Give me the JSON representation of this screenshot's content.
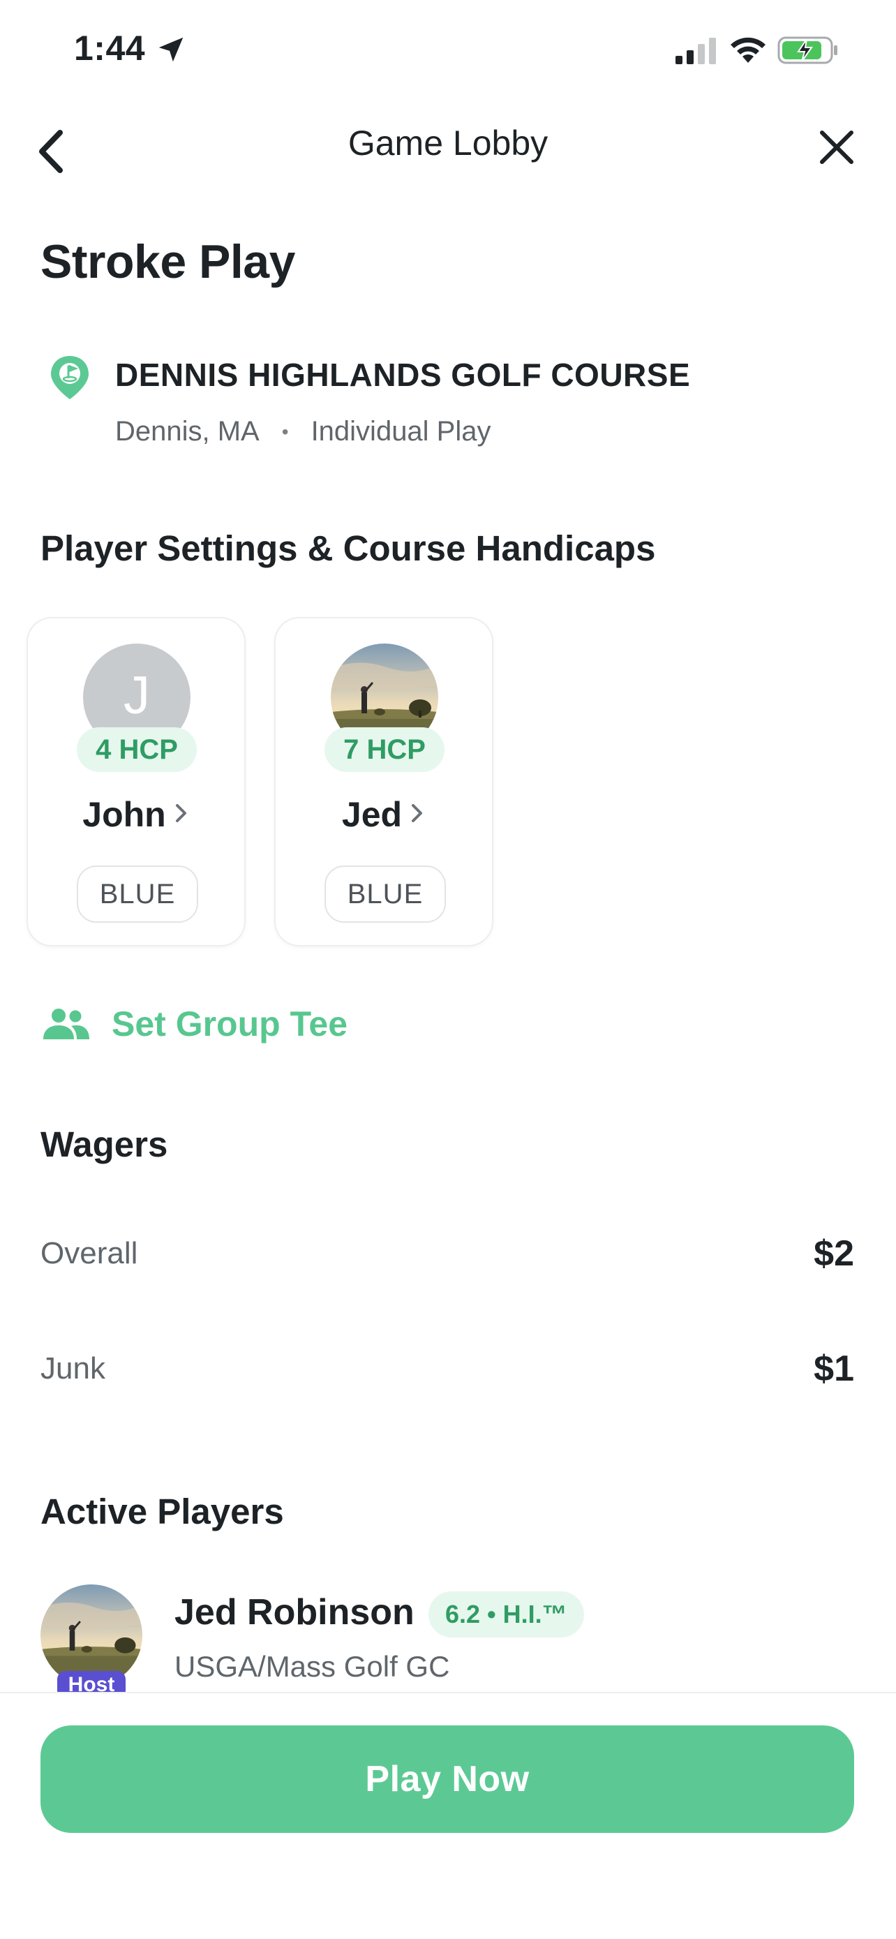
{
  "status_bar": {
    "time": "1:44",
    "icons": [
      "location-arrow-icon",
      "cellular-signal-icon",
      "wifi-icon",
      "battery-charging-icon"
    ]
  },
  "nav": {
    "title": "Game Lobby",
    "back_icon": "chevron-left-icon",
    "close_icon": "close-icon"
  },
  "game": {
    "title": "Stroke Play"
  },
  "course": {
    "icon": "golf-pin-icon",
    "name": "DENNIS HIGHLANDS GOLF COURSE",
    "location": "Dennis, MA",
    "separator": "•",
    "play_type": "Individual Play"
  },
  "player_settings": {
    "title": "Player Settings & Course Handicaps",
    "players": [
      {
        "initial": "J",
        "hcp": "4 HCP",
        "name": "John",
        "tee": "BLUE",
        "avatar": "initial"
      },
      {
        "initial": "",
        "hcp": "7 HCP",
        "name": "Jed",
        "tee": "BLUE",
        "avatar": "photo"
      }
    ]
  },
  "group_tee": {
    "icon": "group-users-icon",
    "label": "Set Group Tee"
  },
  "wagers": {
    "title": "Wagers",
    "rows": [
      {
        "label": "Overall",
        "value": "$2"
      },
      {
        "label": "Junk",
        "value": "$1"
      }
    ]
  },
  "active_players": {
    "title": "Active Players",
    "players": [
      {
        "name": "Jed Robinson",
        "hi": "6.2 • H.I.™",
        "club": "USGA/Mass Golf GC",
        "host_label": "Host"
      }
    ]
  },
  "footer": {
    "play_label": "Play Now"
  },
  "colors": {
    "accent_green": "#5cc994",
    "badge_green_text": "#2f9c63",
    "badge_green_bg": "#e6f7ee",
    "host_purple": "#5a4ed1"
  }
}
